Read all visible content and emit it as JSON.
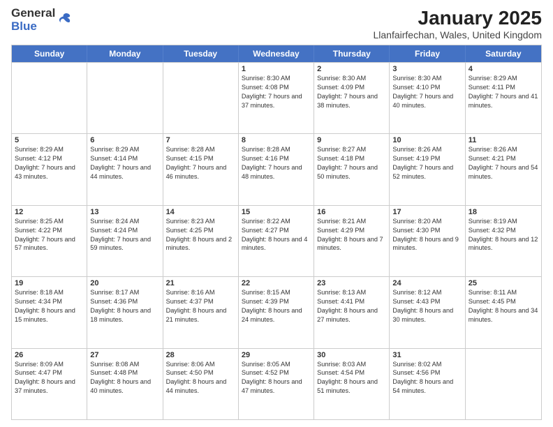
{
  "logo": {
    "general": "General",
    "blue": "Blue"
  },
  "title": "January 2025",
  "subtitle": "Llanfairfechan, Wales, United Kingdom",
  "days": [
    "Sunday",
    "Monday",
    "Tuesday",
    "Wednesday",
    "Thursday",
    "Friday",
    "Saturday"
  ],
  "weeks": [
    [
      {
        "day": "",
        "sunrise": "",
        "sunset": "",
        "daylight": ""
      },
      {
        "day": "",
        "sunrise": "",
        "sunset": "",
        "daylight": ""
      },
      {
        "day": "",
        "sunrise": "",
        "sunset": "",
        "daylight": ""
      },
      {
        "day": "1",
        "sunrise": "Sunrise: 8:30 AM",
        "sunset": "Sunset: 4:08 PM",
        "daylight": "Daylight: 7 hours and 37 minutes."
      },
      {
        "day": "2",
        "sunrise": "Sunrise: 8:30 AM",
        "sunset": "Sunset: 4:09 PM",
        "daylight": "Daylight: 7 hours and 38 minutes."
      },
      {
        "day": "3",
        "sunrise": "Sunrise: 8:30 AM",
        "sunset": "Sunset: 4:10 PM",
        "daylight": "Daylight: 7 hours and 40 minutes."
      },
      {
        "day": "4",
        "sunrise": "Sunrise: 8:29 AM",
        "sunset": "Sunset: 4:11 PM",
        "daylight": "Daylight: 7 hours and 41 minutes."
      }
    ],
    [
      {
        "day": "5",
        "sunrise": "Sunrise: 8:29 AM",
        "sunset": "Sunset: 4:12 PM",
        "daylight": "Daylight: 7 hours and 43 minutes."
      },
      {
        "day": "6",
        "sunrise": "Sunrise: 8:29 AM",
        "sunset": "Sunset: 4:14 PM",
        "daylight": "Daylight: 7 hours and 44 minutes."
      },
      {
        "day": "7",
        "sunrise": "Sunrise: 8:28 AM",
        "sunset": "Sunset: 4:15 PM",
        "daylight": "Daylight: 7 hours and 46 minutes."
      },
      {
        "day": "8",
        "sunrise": "Sunrise: 8:28 AM",
        "sunset": "Sunset: 4:16 PM",
        "daylight": "Daylight: 7 hours and 48 minutes."
      },
      {
        "day": "9",
        "sunrise": "Sunrise: 8:27 AM",
        "sunset": "Sunset: 4:18 PM",
        "daylight": "Daylight: 7 hours and 50 minutes."
      },
      {
        "day": "10",
        "sunrise": "Sunrise: 8:26 AM",
        "sunset": "Sunset: 4:19 PM",
        "daylight": "Daylight: 7 hours and 52 minutes."
      },
      {
        "day": "11",
        "sunrise": "Sunrise: 8:26 AM",
        "sunset": "Sunset: 4:21 PM",
        "daylight": "Daylight: 7 hours and 54 minutes."
      }
    ],
    [
      {
        "day": "12",
        "sunrise": "Sunrise: 8:25 AM",
        "sunset": "Sunset: 4:22 PM",
        "daylight": "Daylight: 7 hours and 57 minutes."
      },
      {
        "day": "13",
        "sunrise": "Sunrise: 8:24 AM",
        "sunset": "Sunset: 4:24 PM",
        "daylight": "Daylight: 7 hours and 59 minutes."
      },
      {
        "day": "14",
        "sunrise": "Sunrise: 8:23 AM",
        "sunset": "Sunset: 4:25 PM",
        "daylight": "Daylight: 8 hours and 2 minutes."
      },
      {
        "day": "15",
        "sunrise": "Sunrise: 8:22 AM",
        "sunset": "Sunset: 4:27 PM",
        "daylight": "Daylight: 8 hours and 4 minutes."
      },
      {
        "day": "16",
        "sunrise": "Sunrise: 8:21 AM",
        "sunset": "Sunset: 4:29 PM",
        "daylight": "Daylight: 8 hours and 7 minutes."
      },
      {
        "day": "17",
        "sunrise": "Sunrise: 8:20 AM",
        "sunset": "Sunset: 4:30 PM",
        "daylight": "Daylight: 8 hours and 9 minutes."
      },
      {
        "day": "18",
        "sunrise": "Sunrise: 8:19 AM",
        "sunset": "Sunset: 4:32 PM",
        "daylight": "Daylight: 8 hours and 12 minutes."
      }
    ],
    [
      {
        "day": "19",
        "sunrise": "Sunrise: 8:18 AM",
        "sunset": "Sunset: 4:34 PM",
        "daylight": "Daylight: 8 hours and 15 minutes."
      },
      {
        "day": "20",
        "sunrise": "Sunrise: 8:17 AM",
        "sunset": "Sunset: 4:36 PM",
        "daylight": "Daylight: 8 hours and 18 minutes."
      },
      {
        "day": "21",
        "sunrise": "Sunrise: 8:16 AM",
        "sunset": "Sunset: 4:37 PM",
        "daylight": "Daylight: 8 hours and 21 minutes."
      },
      {
        "day": "22",
        "sunrise": "Sunrise: 8:15 AM",
        "sunset": "Sunset: 4:39 PM",
        "daylight": "Daylight: 8 hours and 24 minutes."
      },
      {
        "day": "23",
        "sunrise": "Sunrise: 8:13 AM",
        "sunset": "Sunset: 4:41 PM",
        "daylight": "Daylight: 8 hours and 27 minutes."
      },
      {
        "day": "24",
        "sunrise": "Sunrise: 8:12 AM",
        "sunset": "Sunset: 4:43 PM",
        "daylight": "Daylight: 8 hours and 30 minutes."
      },
      {
        "day": "25",
        "sunrise": "Sunrise: 8:11 AM",
        "sunset": "Sunset: 4:45 PM",
        "daylight": "Daylight: 8 hours and 34 minutes."
      }
    ],
    [
      {
        "day": "26",
        "sunrise": "Sunrise: 8:09 AM",
        "sunset": "Sunset: 4:47 PM",
        "daylight": "Daylight: 8 hours and 37 minutes."
      },
      {
        "day": "27",
        "sunrise": "Sunrise: 8:08 AM",
        "sunset": "Sunset: 4:48 PM",
        "daylight": "Daylight: 8 hours and 40 minutes."
      },
      {
        "day": "28",
        "sunrise": "Sunrise: 8:06 AM",
        "sunset": "Sunset: 4:50 PM",
        "daylight": "Daylight: 8 hours and 44 minutes."
      },
      {
        "day": "29",
        "sunrise": "Sunrise: 8:05 AM",
        "sunset": "Sunset: 4:52 PM",
        "daylight": "Daylight: 8 hours and 47 minutes."
      },
      {
        "day": "30",
        "sunrise": "Sunrise: 8:03 AM",
        "sunset": "Sunset: 4:54 PM",
        "daylight": "Daylight: 8 hours and 51 minutes."
      },
      {
        "day": "31",
        "sunrise": "Sunrise: 8:02 AM",
        "sunset": "Sunset: 4:56 PM",
        "daylight": "Daylight: 8 hours and 54 minutes."
      },
      {
        "day": "",
        "sunrise": "",
        "sunset": "",
        "daylight": ""
      }
    ]
  ]
}
